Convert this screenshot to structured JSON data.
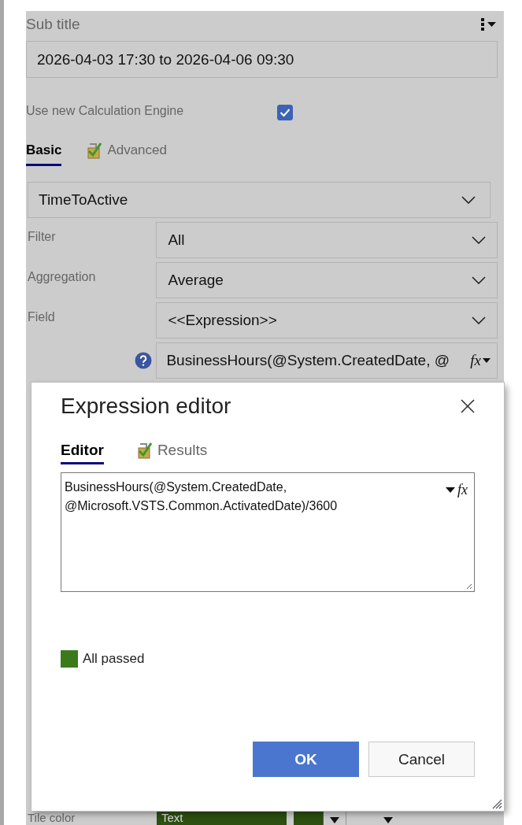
{
  "header": {
    "title": "Sub title"
  },
  "subtitle_field": {
    "value": "2026-04-03 17:30 to 2026-04-06 09:30"
  },
  "calc_engine": {
    "label": "Use new Calculation Engine",
    "checked": true
  },
  "tabs": [
    {
      "label": "Basic",
      "selected": true,
      "kind": "plain"
    },
    {
      "label": "Advanced",
      "selected": false,
      "kind": "icon"
    }
  ],
  "metric": {
    "value": "TimeToActive"
  },
  "rows": [
    {
      "label": "Filter",
      "value": "All"
    },
    {
      "label": "Aggregation",
      "value": "Average"
    },
    {
      "label": "Field",
      "value": "<<Expression>>"
    }
  ],
  "expression_field": {
    "value": "BusinessHours(@System.CreatedDate, @",
    "button": "fx"
  },
  "tile_color": {
    "label": "Tile color",
    "value": "Text"
  },
  "dialog": {
    "title": "Expression editor",
    "tabs": [
      {
        "label": "Editor",
        "selected": true,
        "kind": "plain"
      },
      {
        "label": "Results",
        "selected": false,
        "kind": "icon"
      }
    ],
    "function_button": "fx",
    "expression": "BusinessHours(@System.CreatedDate, @Microsoft.VSTS.Common.ActivatedDate)/3600",
    "status": "All passed",
    "buttons": [
      {
        "label": "OK",
        "kind": "primary"
      },
      {
        "label": "Cancel",
        "kind": "secondary"
      }
    ]
  }
}
